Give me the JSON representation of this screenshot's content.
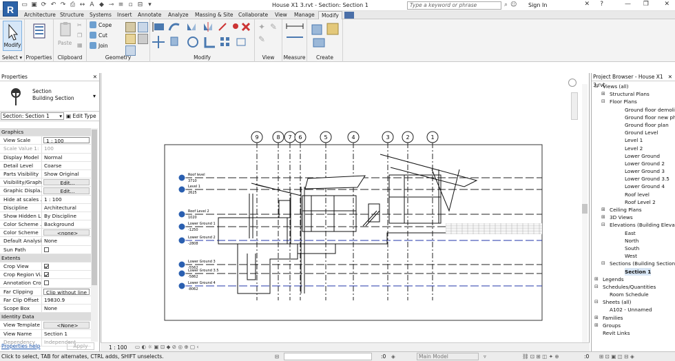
{
  "window": {
    "title": "House X1 3.rvt - Section: Section 1",
    "app_icon": "R",
    "search_placeholder": "Type a keyword or phrase",
    "sign_in": "Sign In"
  },
  "tabs": [
    "Architecture",
    "Structure",
    "Systems",
    "Insert",
    "Annotate",
    "Analyze",
    "Massing & Site",
    "Collaborate",
    "View",
    "Manage",
    "Modify"
  ],
  "active_tab": "Modify",
  "ribbon": {
    "select": {
      "modify_label": "Modify",
      "panel": "Select ▾"
    },
    "properties_panel": "Properties",
    "clipboard": {
      "panel": "Clipboard",
      "paste": "Paste"
    },
    "geometry": {
      "panel": "Geometry",
      "cope": "Cope",
      "cut": "Cut",
      "join": "Join"
    },
    "modify_panel": "Modify",
    "view_panel": "View",
    "measure_panel": "Measure",
    "create_panel": "Create"
  },
  "properties": {
    "title": "Properties",
    "type_name": "Section",
    "type_sub": "Building Section",
    "instance": "Section: Section 1",
    "edit_type": "Edit Type",
    "groups": [
      {
        "name": "Graphics",
        "rows": [
          {
            "k": "View Scale",
            "v": "1 : 100",
            "style": "box"
          },
          {
            "k": "Scale Value    1:",
            "v": "100",
            "style": "dim"
          },
          {
            "k": "Display Model",
            "v": "Normal"
          },
          {
            "k": "Detail Level",
            "v": "Coarse"
          },
          {
            "k": "Parts Visibility",
            "v": "Show Original"
          },
          {
            "k": "Visibility/Graph...",
            "v": "Edit...",
            "style": "btn"
          },
          {
            "k": "Graphic Displa...",
            "v": "Edit...",
            "style": "btn"
          },
          {
            "k": "Hide at scales ...",
            "v": "1 : 100"
          },
          {
            "k": "Discipline",
            "v": "Architectural"
          },
          {
            "k": "Show Hidden L...",
            "v": "By Discipline"
          },
          {
            "k": "Color Scheme ...",
            "v": "Background"
          },
          {
            "k": "Color Scheme",
            "v": "<none>",
            "style": "btn"
          },
          {
            "k": "Default Analysi...",
            "v": "None"
          },
          {
            "k": "Sun Path",
            "v": "",
            "check": false
          }
        ]
      },
      {
        "name": "Extents",
        "rows": [
          {
            "k": "Crop View",
            "v": "",
            "check": true
          },
          {
            "k": "Crop Region Vi...",
            "v": "",
            "check": true
          },
          {
            "k": "Annotation Crop",
            "v": "",
            "check": false
          },
          {
            "k": "Far Clipping",
            "v": "Clip without line",
            "style": "box"
          },
          {
            "k": "Far Clip Offset",
            "v": "19830.9"
          },
          {
            "k": "Scope Box",
            "v": "None"
          }
        ]
      },
      {
        "name": "Identity Data",
        "rows": [
          {
            "k": "View Template",
            "v": "<None>",
            "style": "btn"
          },
          {
            "k": "View Name",
            "v": "Section 1"
          },
          {
            "k": "Dependency",
            "v": "Independent",
            "style": "dim"
          }
        ]
      }
    ],
    "help": "Properties help",
    "apply": "Apply"
  },
  "view": {
    "scale": "1 : 100",
    "grids": [
      "9",
      "8",
      "7",
      "6",
      "5",
      "4",
      "3",
      "2",
      "1"
    ],
    "levels": [
      {
        "name": "Roof level",
        "elev": "3710"
      },
      {
        "name": "Level 1",
        "elev": "2625"
      },
      {
        "name": "Roof Level 2",
        "elev": "1020"
      },
      {
        "name": "Lower Ground 1",
        "elev": "-1250"
      },
      {
        "name": "Lower Ground 2",
        "elev": "-2808"
      },
      {
        "name": "Lower Ground 3",
        "elev": "-5562"
      },
      {
        "name": "Lower Ground 3.5",
        "elev": "-5862"
      },
      {
        "name": "Lower Ground 4",
        "elev": "-8062"
      }
    ]
  },
  "browser": {
    "title": "Project Browser - House X1 3.rvt",
    "nodes": [
      {
        "t": "Views (all)",
        "lvl": 0,
        "tg": "−"
      },
      {
        "t": "Structural Plans",
        "lvl": 1,
        "tg": "+"
      },
      {
        "t": "Floor Plans",
        "lvl": 1,
        "tg": "−"
      },
      {
        "t": "Ground floor demolished",
        "lvl": 2
      },
      {
        "t": "Ground floor new phase",
        "lvl": 2
      },
      {
        "t": "Ground floor plan",
        "lvl": 2
      },
      {
        "t": "Ground Level",
        "lvl": 2
      },
      {
        "t": "Level 1",
        "lvl": 2
      },
      {
        "t": "Level 2",
        "lvl": 2
      },
      {
        "t": "Lower Ground",
        "lvl": 2
      },
      {
        "t": "Lower Ground 2",
        "lvl": 2
      },
      {
        "t": "Lower Ground 3",
        "lvl": 2
      },
      {
        "t": "Lower Ground 3.5",
        "lvl": 2
      },
      {
        "t": "Lower Ground 4",
        "lvl": 2
      },
      {
        "t": "Roof level",
        "lvl": 2
      },
      {
        "t": "Roof Level 2",
        "lvl": 2
      },
      {
        "t": "Ceiling Plans",
        "lvl": 1,
        "tg": "+"
      },
      {
        "t": "3D Views",
        "lvl": 1,
        "tg": "+"
      },
      {
        "t": "Elevations (Building Elevation)",
        "lvl": 1,
        "tg": "−"
      },
      {
        "t": "East",
        "lvl": 2
      },
      {
        "t": "North",
        "lvl": 2
      },
      {
        "t": "South",
        "lvl": 2
      },
      {
        "t": "West",
        "lvl": 2
      },
      {
        "t": "Sections (Building Section)",
        "lvl": 1,
        "tg": "−"
      },
      {
        "t": "Section 1",
        "lvl": 2,
        "sel": true
      },
      {
        "t": "Legends",
        "lvl": 0,
        "tg": "+"
      },
      {
        "t": "Schedules/Quantities",
        "lvl": 0,
        "tg": "−"
      },
      {
        "t": "Room Schedule",
        "lvl": 1
      },
      {
        "t": "Sheets (all)",
        "lvl": 0,
        "tg": "−"
      },
      {
        "t": "A102 - Unnamed",
        "lvl": 1
      },
      {
        "t": "Families",
        "lvl": 0,
        "tg": "+"
      },
      {
        "t": "Groups",
        "lvl": 0,
        "tg": "+"
      },
      {
        "t": "Revit Links",
        "lvl": 0
      }
    ]
  },
  "status": {
    "text": "Click to select, TAB for alternates, CTRL adds, SHIFT unselects.",
    "zero1": ":0",
    "model": "Main Model",
    "zero2": ":0"
  }
}
